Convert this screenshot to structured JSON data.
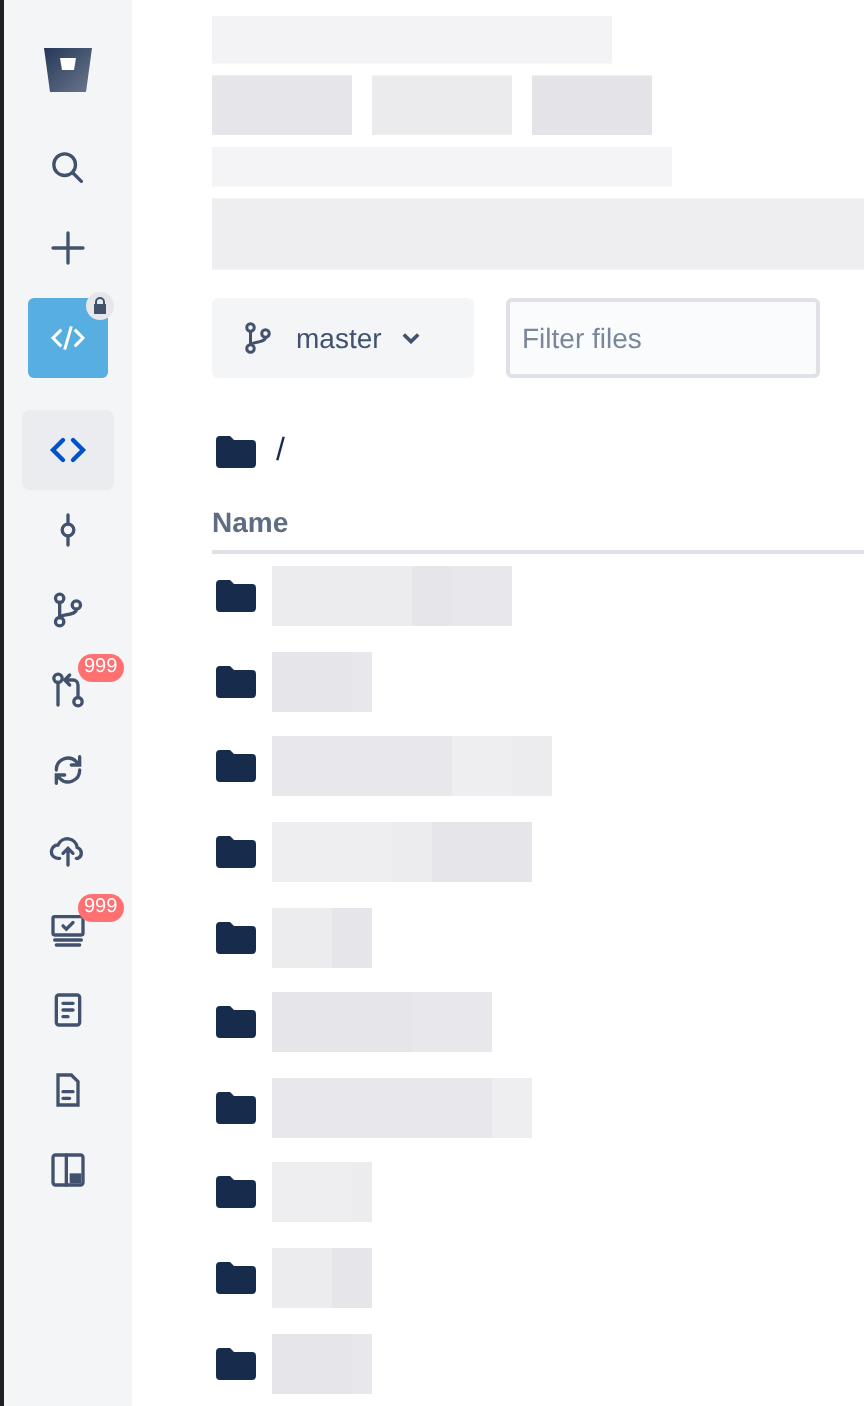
{
  "sidebar": {
    "items": [
      {
        "selected": false
      },
      {
        "selected": false
      },
      {
        "selected": false
      },
      {
        "selected": true
      },
      {
        "selected": false
      },
      {
        "selected": false
      },
      {
        "selected": false,
        "badge": "999"
      },
      {
        "selected": false
      },
      {
        "selected": false
      },
      {
        "selected": false,
        "badge": "999"
      },
      {
        "selected": false
      },
      {
        "selected": false
      },
      {
        "selected": false
      }
    ]
  },
  "branch": {
    "label": "master"
  },
  "filter": {
    "placeholder": "Filter files"
  },
  "breadcrumb": "/",
  "table": {
    "columns": [
      "Name"
    ],
    "rows": [
      {
        "kind": "folder"
      },
      {
        "kind": "folder"
      },
      {
        "kind": "folder"
      },
      {
        "kind": "folder"
      },
      {
        "kind": "folder"
      },
      {
        "kind": "folder"
      },
      {
        "kind": "folder"
      },
      {
        "kind": "folder"
      },
      {
        "kind": "folder"
      },
      {
        "kind": "folder"
      }
    ]
  }
}
